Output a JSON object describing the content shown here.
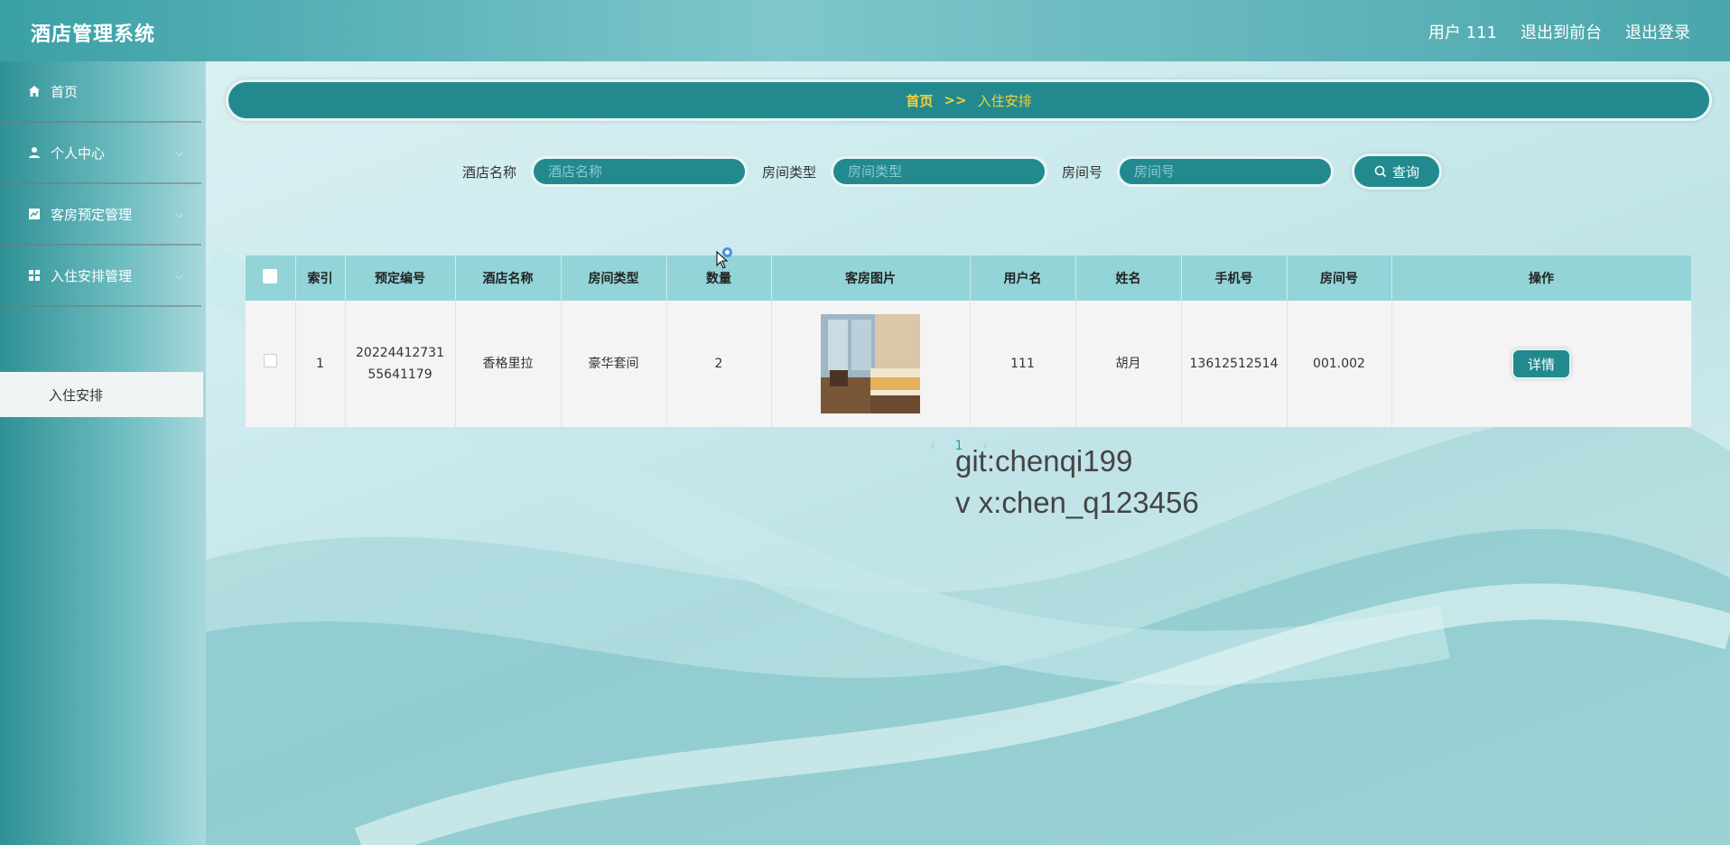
{
  "header": {
    "app_title": "酒店管理系统",
    "user_label": "用户 111",
    "back_to_front": "退出到前台",
    "logout": "退出登录"
  },
  "sidebar": {
    "items": [
      {
        "label": "首页",
        "icon": "home-icon"
      },
      {
        "label": "个人中心",
        "icon": "user-icon"
      },
      {
        "label": "客房预定管理",
        "icon": "chart-icon"
      },
      {
        "label": "入住安排管理",
        "icon": "grid-icon"
      }
    ],
    "sub_item": "入住安排"
  },
  "breadcrumb": {
    "home": "首页",
    "separator": ">>",
    "current": "入住安排"
  },
  "search": {
    "hotel_label": "酒店名称",
    "hotel_placeholder": "酒店名称",
    "room_type_label": "房间类型",
    "room_type_placeholder": "房间类型",
    "room_no_label": "房间号",
    "room_no_placeholder": "房间号",
    "button": "查询"
  },
  "table": {
    "headers": [
      "索引",
      "预定编号",
      "酒店名称",
      "房间类型",
      "数量",
      "客房图片",
      "用户名",
      "姓名",
      "手机号",
      "房间号",
      "操作"
    ],
    "rows": [
      {
        "index": "1",
        "order_no": "2022441273155641179",
        "hotel": "香格里拉",
        "room_type": "豪华套间",
        "qty": "2",
        "username": "111",
        "name": "胡月",
        "phone": "13612512514",
        "room_no": "001.002",
        "action": "详情"
      }
    ]
  },
  "pager": {
    "prev": "‹",
    "page": "1",
    "next": "›"
  },
  "watermark": {
    "line1": "git:chenqi199",
    "line2": "v x:chen_q123456"
  },
  "colors": {
    "primary": "#228a8f",
    "header_bg": "#92d4d8",
    "accent_text": "#f2d13b"
  }
}
